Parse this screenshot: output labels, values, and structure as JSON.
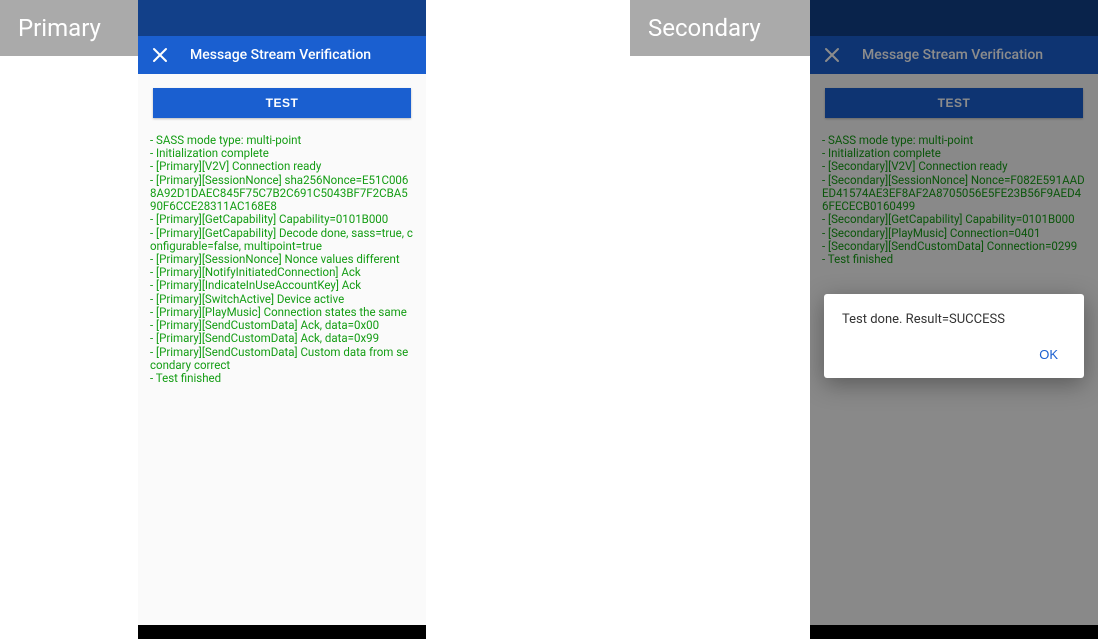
{
  "colors": {
    "statusbar": "#124089",
    "appbar": "#1a5fd0",
    "log_text": "#149d14",
    "tag_bg": "#aaaaaa"
  },
  "tags": {
    "primary": "Primary",
    "secondary": "Secondary"
  },
  "appbar": {
    "title": "Message Stream Verification"
  },
  "test_button_label": "TEST",
  "primary_log_lines": [
    " - SASS mode type: multi-point",
    " - Initialization complete",
    " - [Primary][V2V] Connection ready",
    " - [Primary][SessionNonce] sha256Nonce=E51C0068A92D1DAEC845F75C7B2C691C5043BF7F2CBA590F6CCE28311AC168E8",
    " - [Primary][GetCapability] Capability=0101B000",
    " - [Primary][GetCapability] Decode done, sass=true, configurable=false, multipoint=true",
    " - [Primary][SessionNonce] Nonce values different",
    " - [Primary][NotifyInitiatedConnection] Ack",
    " - [Primary][IndicateInUseAccountKey] Ack",
    " - [Primary][SwitchActive] Device active",
    " - [Primary][PlayMusic] Connection states the same",
    " - [Primary][SendCustomData] Ack, data=0x00",
    " - [Primary][SendCustomData] Ack, data=0x99",
    " - [Primary][SendCustomData] Custom data from secondary correct",
    " - Test finished"
  ],
  "secondary_log_lines": [
    " - SASS mode type: multi-point",
    " - Initialization complete",
    " - [Secondary][V2V] Connection ready",
    " - [Secondary][SessionNonce] Nonce=F082E591AADED41574AE3EF8AF2A8705056E5FE23B56F9AED46FECECB0160499",
    " - [Secondary][GetCapability] Capability=0101B000",
    " - [Secondary][PlayMusic] Connection=0401",
    " - [Secondary][SendCustomData] Connection=0299",
    " - Test finished"
  ],
  "dialog": {
    "text": "Test done. Result=SUCCESS",
    "ok": "OK"
  }
}
